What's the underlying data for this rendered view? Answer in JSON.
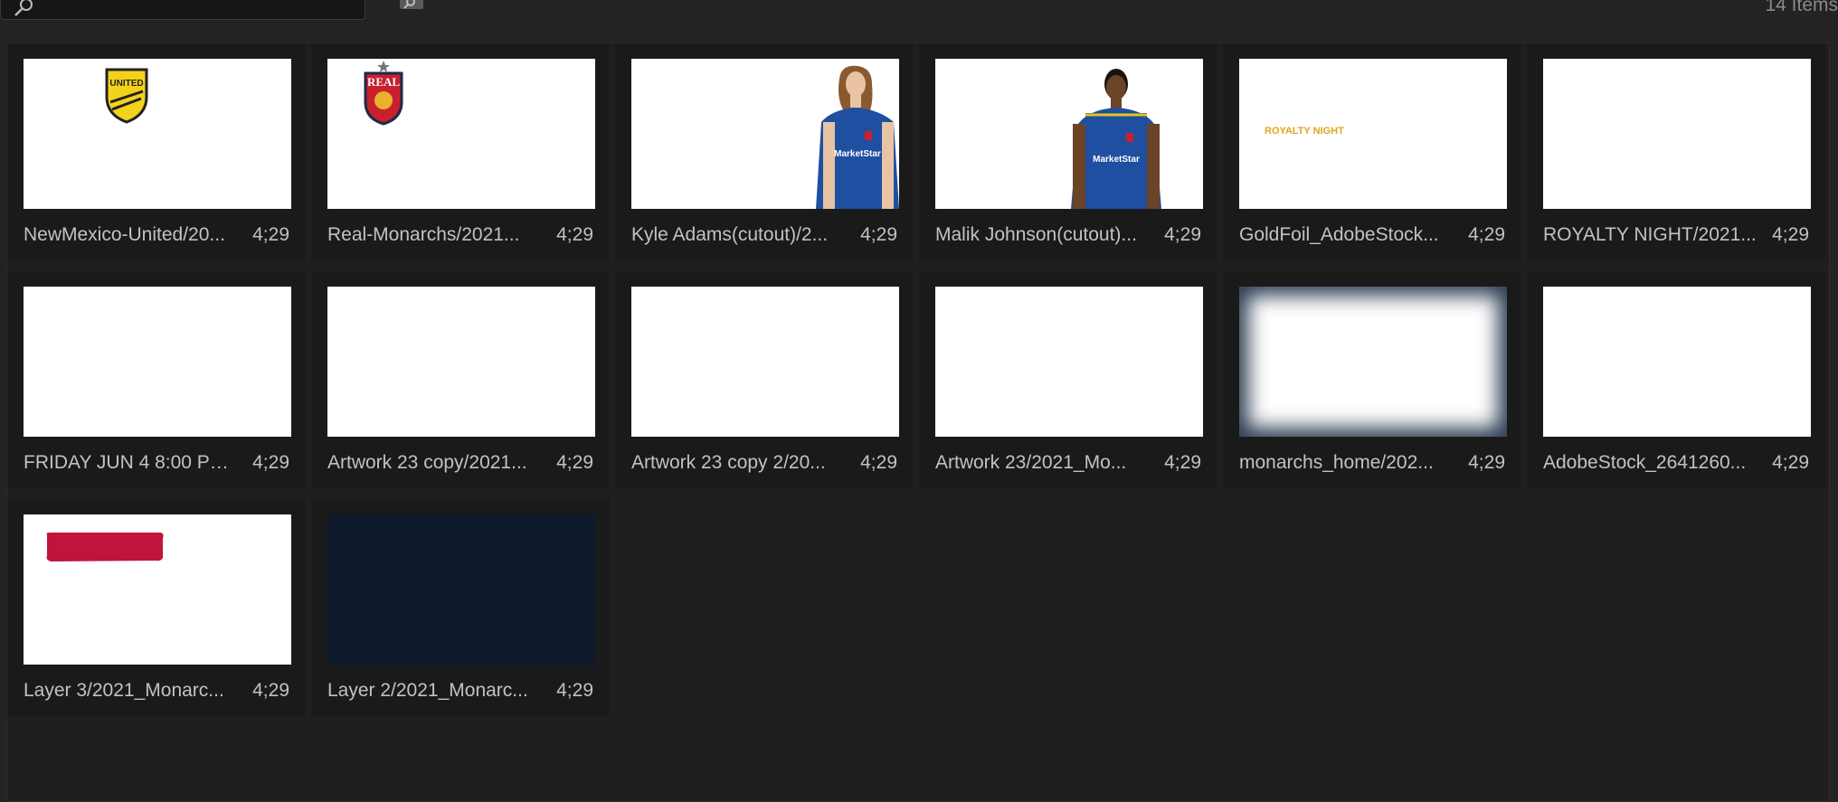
{
  "search": {
    "placeholder": "",
    "value": ""
  },
  "toolbar": {
    "new_bin_icon": "new-bin-icon"
  },
  "item_count": "14 Items",
  "items": [
    {
      "name": "NewMexico-United/20...",
      "duration": "4;29"
    },
    {
      "name": "Real-Monarchs/2021...",
      "duration": "4;29"
    },
    {
      "name": "Kyle Adams(cutout)/2...",
      "duration": "4;29"
    },
    {
      "name": "Malik Johnson(cutout)...",
      "duration": "4;29"
    },
    {
      "name": "GoldFoil_AdobeStock...",
      "duration": "4;29"
    },
    {
      "name": "ROYALTY NIGHT/2021...",
      "duration": "4;29"
    },
    {
      "name": "FRIDAY JUN 4 8:00 PM...",
      "duration": "4;29"
    },
    {
      "name": "Artwork 23 copy/2021...",
      "duration": "4;29"
    },
    {
      "name": "Artwork 23 copy 2/20...",
      "duration": "4;29"
    },
    {
      "name": "Artwork 23/2021_Mo...",
      "duration": "4;29"
    },
    {
      "name": "monarchs_home/202...",
      "duration": "4;29"
    },
    {
      "name": "AdobeStock_2641260...",
      "duration": "4;29"
    },
    {
      "name": "Layer 3/2021_Monarc...",
      "duration": "4;29"
    },
    {
      "name": "Layer 2/2021_Monarc...",
      "duration": "4;29"
    }
  ],
  "thumbnails": {
    "logo_united_text": "UNITED",
    "logo_real_text": "REAL",
    "jersey_sponsor": "MarketStar",
    "royalty_text": "ROYALTY NIGHT"
  },
  "colors": {
    "background": "#232323",
    "panel": "#1f1f1f",
    "cell": "#1a1a1a",
    "gold": "#d9a81e",
    "brush_red": "#c0143c",
    "navy": "#0e1a2c",
    "jersey_blue": "#1f4fa0"
  }
}
